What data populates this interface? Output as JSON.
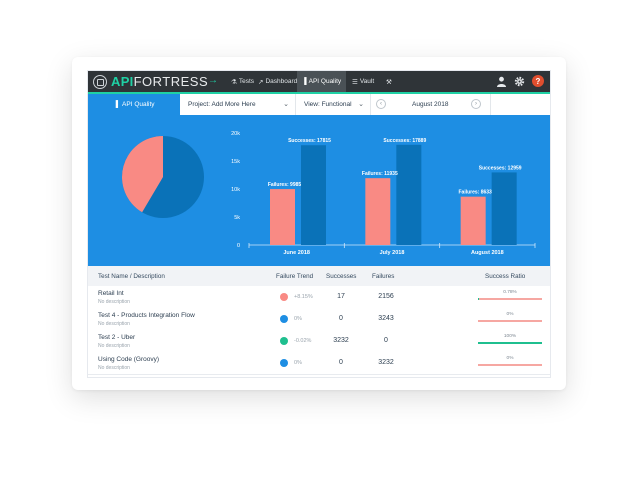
{
  "brand": {
    "api": "API",
    "fortress": "FORTRESS"
  },
  "nav": {
    "arrow": "→",
    "items": [
      {
        "label": "Tests",
        "icon": "flask-icon"
      },
      {
        "label": "Dashboard",
        "icon": "chart-icon"
      },
      {
        "label": "API Quality",
        "icon": "bar-chart-icon"
      },
      {
        "label": "Vault",
        "icon": "vault-icon"
      }
    ],
    "right_icons": [
      "user-icon",
      "gear-icon",
      "help-icon"
    ]
  },
  "subbar": {
    "tab": "API Quality",
    "project": "Project: Add More Here",
    "view": "View: Functional",
    "month": "August 2018"
  },
  "colors": {
    "accent": "#1e8ee3",
    "failure": "#f98a84",
    "success": "#0a72b8",
    "teal": "#1fd1a5"
  },
  "pie": {
    "failures_fraction": 0.415,
    "successes_fraction": 0.585
  },
  "chart_data": {
    "type": "bar",
    "categories": [
      "June 2018",
      "July 2018",
      "August 2018"
    ],
    "series": [
      {
        "name": "Failures",
        "values": [
          9985,
          11935,
          8633
        ]
      },
      {
        "name": "Successes",
        "values": [
          17815,
          17889,
          12959
        ]
      }
    ],
    "value_labels": {
      "Failures": [
        "Failures: 9985",
        "Failures: 11935",
        "Failures: 8633"
      ],
      "Successes": [
        "Successes: 17815",
        "Successes: 17889",
        "Successes: 12959"
      ]
    },
    "yticks": [
      "0",
      "5k",
      "10k",
      "15k",
      "20k"
    ],
    "ylim": [
      0,
      20000
    ],
    "grid": false
  },
  "table": {
    "headers": [
      "Test Name / Description",
      "Failure Trend",
      "Successes",
      "Failures",
      "Success Ratio"
    ],
    "rows": [
      {
        "name": "Retail Int",
        "desc": "No description",
        "trend": "+8.15%",
        "trend_color": "#f98a84",
        "successes": "17",
        "failures": "2156",
        "ratio_label": "0.78%",
        "ratio": 0.0078
      },
      {
        "name": "Test 4 - Products Integration Flow",
        "desc": "No description",
        "trend": "0%",
        "trend_color": "#1e8ee3",
        "successes": "0",
        "failures": "3243",
        "ratio_label": "0%",
        "ratio": 0
      },
      {
        "name": "Test 2 - Uber",
        "desc": "No description",
        "trend": "-0.02%",
        "trend_color": "#1fbf8f",
        "successes": "3232",
        "failures": "0",
        "ratio_label": "100%",
        "ratio": 1
      },
      {
        "name": "Using Code (Groovy)",
        "desc": "No description",
        "trend": "0%",
        "trend_color": "#1e8ee3",
        "successes": "0",
        "failures": "3232",
        "ratio_label": "0%",
        "ratio": 0
      }
    ]
  }
}
